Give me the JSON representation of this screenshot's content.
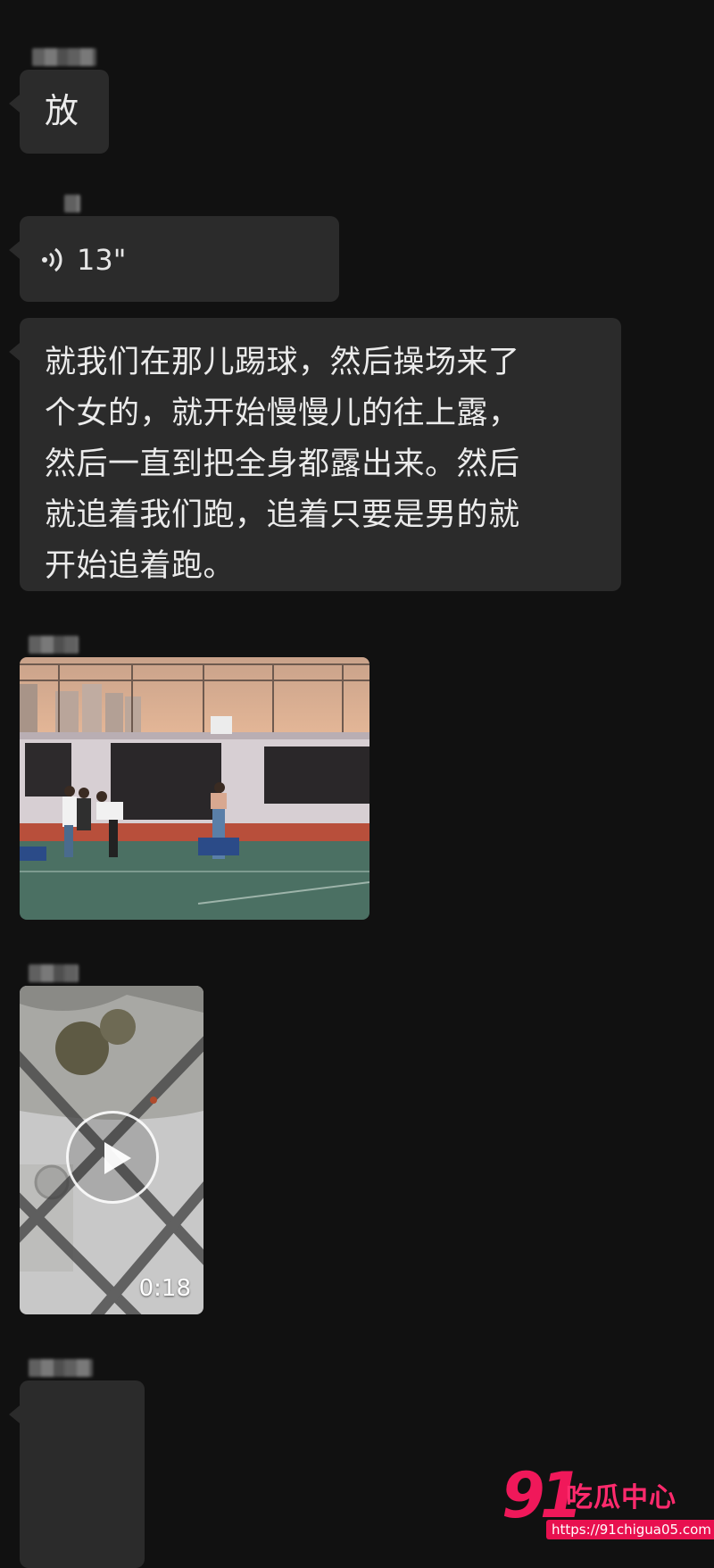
{
  "messages": {
    "m1": {
      "text": "放"
    },
    "m2": {
      "voice_duration": "13\""
    },
    "m3": {
      "lines": [
        "就我们在那儿踢球，然后操场来了",
        "个女的，就开始慢慢儿的往上露，",
        "然后一直到把全身都露出来。然后",
        "就追着我们跑，追着只要是男的就",
        "开始追着跑。"
      ]
    },
    "m5": {
      "video_duration": "0:18"
    }
  },
  "icons": {
    "voice": "voice-wave-icon",
    "play": "play-icon"
  },
  "watermark": {
    "number": "91",
    "title": "吃瓜中心",
    "url": "https://91chigua05.com"
  },
  "colors": {
    "background": "#111111",
    "bubble": "#2b2b2b",
    "watermark_accent": "#f0185a"
  }
}
